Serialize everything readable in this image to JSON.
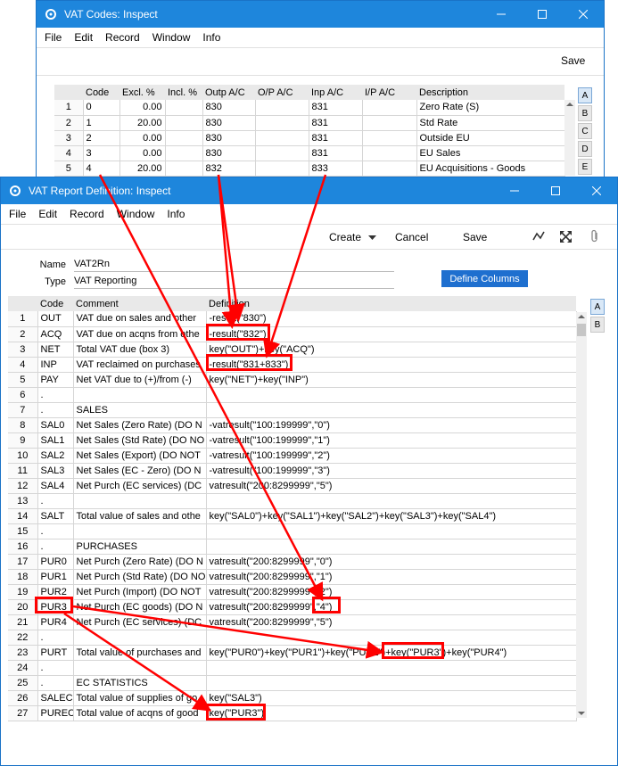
{
  "win1": {
    "title": "VAT Codes: Inspect",
    "menu": [
      "File",
      "Edit",
      "Record",
      "Window",
      "Info"
    ],
    "save_label": "Save",
    "columns": [
      "",
      "Code",
      "Excl. %",
      "Incl. %",
      "Outp A/C",
      "O/P A/C",
      "Inp A/C",
      "I/P A/C",
      "Description"
    ],
    "rows": [
      [
        "1",
        "0",
        "0.00",
        "",
        "830",
        "",
        "831",
        "",
        "Zero Rate (S)"
      ],
      [
        "2",
        "1",
        "20.00",
        "",
        "830",
        "",
        "831",
        "",
        "Std Rate"
      ],
      [
        "3",
        "2",
        "0.00",
        "",
        "830",
        "",
        "831",
        "",
        "Outside EU"
      ],
      [
        "4",
        "3",
        "0.00",
        "",
        "830",
        "",
        "831",
        "",
        "EU Sales"
      ],
      [
        "5",
        "4",
        "20.00",
        "",
        "832",
        "",
        "833",
        "",
        "EU Acquisitions - Goods"
      ]
    ],
    "tabs": [
      "A",
      "B",
      "C",
      "D",
      "E"
    ]
  },
  "win2": {
    "title": "VAT Report Definition: Inspect",
    "menu": [
      "File",
      "Edit",
      "Record",
      "Window",
      "Info"
    ],
    "toolbar": {
      "create": "Create",
      "cancel": "Cancel",
      "save": "Save"
    },
    "name_label": "Name",
    "name_value": "VAT2Rn",
    "type_label": "Type",
    "type_value": "VAT Reporting",
    "define_columns": "Define Columns",
    "columns": [
      "",
      "Code",
      "Comment",
      "Definition"
    ],
    "rows": [
      [
        "1",
        "OUT",
        "VAT due on sales and other",
        "-result(\"830\")"
      ],
      [
        "2",
        "ACQ",
        "VAT due on acqns from othe",
        "-result(\"832\")"
      ],
      [
        "3",
        "NET",
        "Total VAT due (box 3)",
        "key(\"OUT\")+key(\"ACQ\")"
      ],
      [
        "4",
        "INP",
        "VAT reclaimed on purchases",
        "-result(\"831+833\")"
      ],
      [
        "5",
        "PAY",
        "Net VAT due to (+)/from (-)",
        "key(\"NET\")+key(\"INP\")"
      ],
      [
        "6",
        ".",
        "",
        ""
      ],
      [
        "7",
        ".",
        "SALES",
        ""
      ],
      [
        "8",
        "SAL0",
        "Net Sales (Zero Rate)  (DO N",
        "-vatresult(\"100:199999\",\"0\")"
      ],
      [
        "9",
        "SAL1",
        "Net Sales (Std Rate)  (DO NO",
        "-vatresult(\"100:199999\",\"1\")"
      ],
      [
        "10",
        "SAL2",
        "Net Sales (Export)  (DO NOT",
        "-vatresult(\"100:199999\",\"2\")"
      ],
      [
        "11",
        "SAL3",
        "Net Sales (EC - Zero)  (DO N",
        "-vatresult(\"100:199999\",\"3\")"
      ],
      [
        "12",
        "SAL4",
        "Net Purch (EC services)  (DC",
        "vatresult(\"200:8299999\",\"5\")"
      ],
      [
        "13",
        ".",
        "",
        ""
      ],
      [
        "14",
        "SALT",
        "Total value of sales and othe",
        "key(\"SAL0\")+key(\"SAL1\")+key(\"SAL2\")+key(\"SAL3\")+key(\"SAL4\")"
      ],
      [
        "15",
        ".",
        "",
        ""
      ],
      [
        "16",
        ".",
        "PURCHASES",
        ""
      ],
      [
        "17",
        "PUR0",
        "Net Purch (Zero Rate)  (DO N",
        "vatresult(\"200:8299999\",\"0\")"
      ],
      [
        "18",
        "PUR1",
        "Net Purch (Std Rate)  (DO NO",
        "vatresult(\"200:8299999\",\"1\")"
      ],
      [
        "19",
        "PUR2",
        "Net Purch (Import)  (DO NOT",
        "vatresult(\"200:8299999\",\"2\")"
      ],
      [
        "20",
        "PUR3",
        "Net Purch (EC goods)  (DO N",
        "vatresult(\"200:8299999\",\"4\")"
      ],
      [
        "21",
        "PUR4",
        "Net Purch (EC services)  (DC",
        "vatresult(\"200:8299999\",\"5\")"
      ],
      [
        "22",
        ".",
        "",
        ""
      ],
      [
        "23",
        "PURT",
        "Total value of purchases and",
        "key(\"PUR0\")+key(\"PUR1\")+key(\"PUR2\")+key(\"PUR3\")+key(\"PUR4\")"
      ],
      [
        "24",
        ".",
        "",
        ""
      ],
      [
        "25",
        ".",
        "EC STATISTICS",
        ""
      ],
      [
        "26",
        "SALEC",
        "Total value of supplies of go",
        "key(\"SAL3\")"
      ],
      [
        "27",
        "PUREC",
        "Total value of acqns of good",
        "key(\"PUR3\")"
      ]
    ],
    "tabs": [
      "A",
      "B"
    ]
  },
  "colors": {
    "titlebar": "#1e86dc",
    "highlight": "#ff0000",
    "button": "#1e6fcf"
  },
  "icons": [
    "gear-app-icon",
    "minimize-icon",
    "maximize-icon",
    "close-icon",
    "dropdown-caret-icon",
    "graph-icon",
    "expand-icon",
    "paperclip-icon",
    "scroll-up-icon",
    "scroll-down-icon"
  ]
}
